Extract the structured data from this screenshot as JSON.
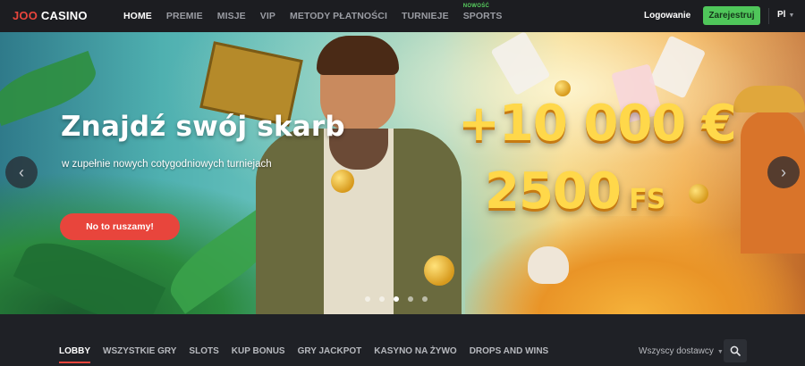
{
  "header": {
    "logo": {
      "part1": "JOO",
      "part2": " CASINO"
    },
    "nav": [
      {
        "label": "HOME",
        "active": true
      },
      {
        "label": "PREMIE"
      },
      {
        "label": "MISJE"
      },
      {
        "label": "VIP"
      },
      {
        "label": "METODY PŁATNOŚCI"
      },
      {
        "label": "TURNIEJE"
      },
      {
        "label": "SPORTS",
        "badge": "NOWOŚĆ"
      }
    ],
    "login_label": "Logowanie",
    "register_label": "Zarejestruj",
    "language": "Pl"
  },
  "hero": {
    "title": "Znajdź swój skarb",
    "subtitle": "w zupełnie nowych cotygodniowych turniejach",
    "cta_label": "No to ruszamy!",
    "promo_line1": "+10 000 €",
    "promo_line2_number": "2500",
    "promo_line2_unit": " FS",
    "slides_total": 5,
    "active_slide": 2
  },
  "lobby": {
    "tabs": [
      {
        "label": "LOBBY",
        "active": true
      },
      {
        "label": "WSZYSTKIE GRY"
      },
      {
        "label": "SLOTS"
      },
      {
        "label": "KUP BONUS"
      },
      {
        "label": "GRY JACKPOT"
      },
      {
        "label": "KASYNO NA ŻYWO"
      },
      {
        "label": "DROPS AND WINS"
      }
    ],
    "provider_filter": "Wszyscy dostawcy"
  },
  "colors": {
    "accent_red": "#e8453c",
    "accent_green": "#4fc65a",
    "background_dark": "#1d1f23"
  },
  "icons": {
    "arrow_left": "chevron-left-icon",
    "arrow_right": "chevron-right-icon",
    "search": "search-icon",
    "caret": "chevron-down-icon"
  }
}
